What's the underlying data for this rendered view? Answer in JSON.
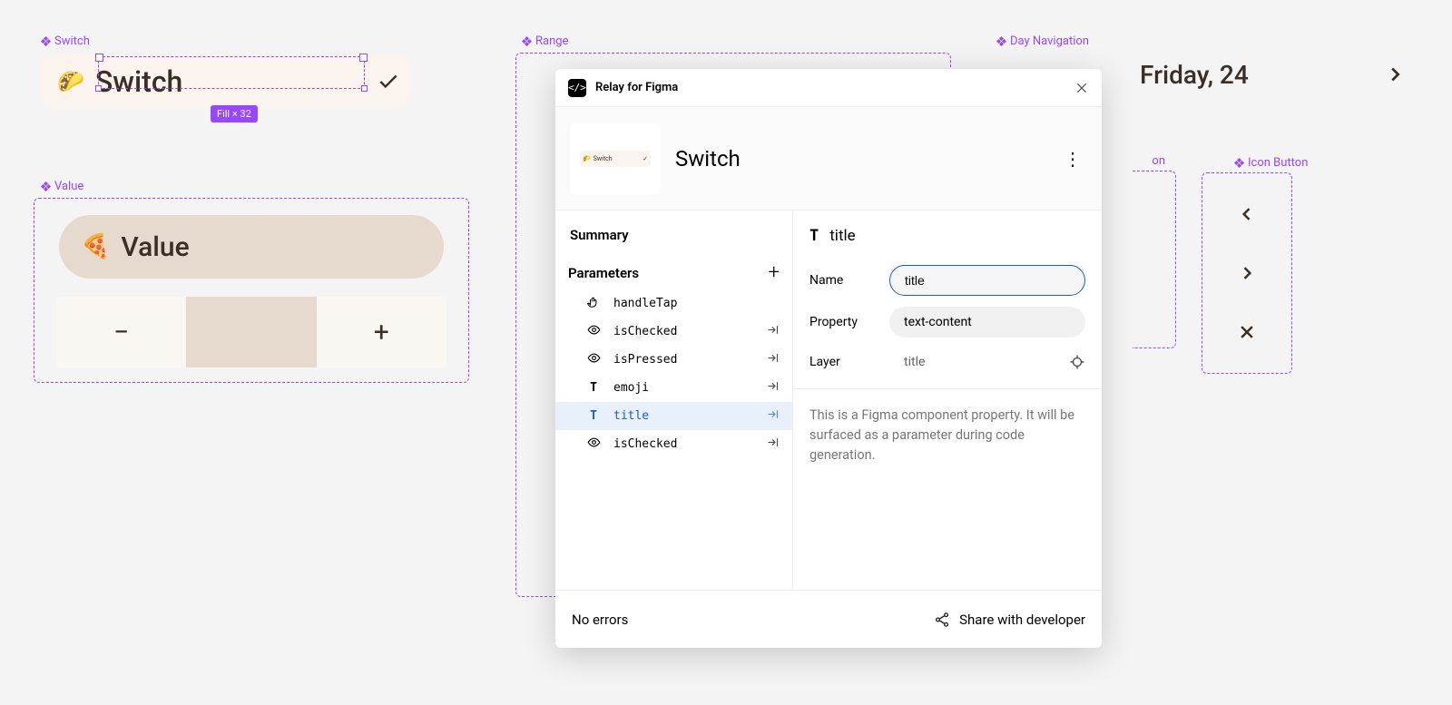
{
  "canvas": {
    "switch": {
      "label": "Switch",
      "emoji": "🌮",
      "title": "Switch",
      "size_badge": "Fill × 32"
    },
    "value": {
      "label": "Value",
      "emoji": "🍕",
      "title": "Value",
      "minus": "−",
      "plus": "+"
    },
    "range": {
      "label": "Range"
    },
    "daynav": {
      "label": "Day Navigation",
      "text": "Friday, 24"
    },
    "truncated": {
      "label_suffix": "on"
    },
    "iconbtn": {
      "label": "Icon Button"
    }
  },
  "popup": {
    "app_title": "Relay for Figma",
    "component_name": "Switch",
    "left": {
      "summary": "Summary",
      "parameters": "Parameters",
      "params": [
        {
          "icon": "tap",
          "name": "handleTap",
          "arrow": false
        },
        {
          "icon": "eye",
          "name": "isChecked",
          "arrow": true
        },
        {
          "icon": "eye",
          "name": "isPressed",
          "arrow": true
        },
        {
          "icon": "text",
          "name": "emoji",
          "arrow": true
        },
        {
          "icon": "text",
          "name": "title",
          "arrow": true,
          "selected": true
        },
        {
          "icon": "eye",
          "name": "isChecked",
          "arrow": true
        }
      ]
    },
    "right": {
      "heading": "title",
      "name_label": "Name",
      "name_value": "title",
      "property_label": "Property",
      "property_value": "text-content",
      "layer_label": "Layer",
      "layer_value": "title",
      "description": "This is a Figma component property. It will be surfaced as a parameter during code generation."
    },
    "footer": {
      "errors": "No errors",
      "share": "Share with developer"
    }
  }
}
